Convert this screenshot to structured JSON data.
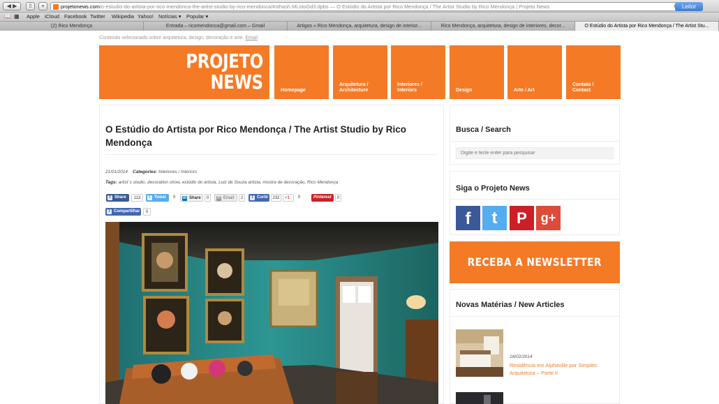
{
  "browser": {
    "url_domain": "projetonews.com",
    "url_rest": "/o-estudio-do-artista-por-rico-mendonca-the-artist-studio-by-rico-mendonca/#sthash.MLotoGd3.dpbs",
    "window_title": " — O Estúdio do Artista por Rico Mendonça / The Artist Studio by Rico Mendonça | Projeto News",
    "reader_label": "Leitor",
    "reload_glyph": "C",
    "bookmarks": [
      "Apple",
      "iCloud",
      "Facebook",
      "Twitter",
      "Wikipedia",
      "Yahoo!",
      "Notícias ▾",
      "Popular ▾"
    ],
    "tabs": [
      "(2) Rico Mendonça",
      "Entrada – ricomendonca@gmail.com – Gmail",
      "Artigos « Rico Mendonça, arquitetura, design de interior...",
      "Rico Mendonça, arquitetura, design de interiores, decor...",
      "O Estúdio do Artista por Rico Mendonça / The Artist Stu..."
    ]
  },
  "site": {
    "tagline": "Conteúdo selecionado sobre arquitetura, design, decoração e arte.",
    "tagline_link": "Email",
    "logo_line1": "PROJETO",
    "logo_line2": "NEWS",
    "menu": [
      "Homepage",
      "Arquitetura /\nArchitecture",
      "Interiores /\nInteriors",
      "Design",
      "Arte / Art",
      "Contato /\nContact"
    ]
  },
  "article": {
    "title": "O Estúdio do Artista por Rico Mendonça / The Artist Studio by Rico Mendonça",
    "date": "21/01/2014",
    "categories_label": "Categories:",
    "categories": "Interiores / Interiors",
    "tags_label": "Tags:",
    "tags": "artist´s studio, decoration show, estúdio do artista, Luiz de Souza artista, mostra de decoração, Rico Mendonça",
    "share": {
      "facebook_label": "Share",
      "facebook_count": "113",
      "twitter_label": "Tweet",
      "twitter_count": "0",
      "linkedin_label": "Share",
      "linkedin_count": "0",
      "email_label": "Email",
      "email_count": "2",
      "curtir_label": "Curtir",
      "curtir_count": "232",
      "gplus_label": "+1",
      "gplus_count": "0",
      "pinterest_label": "Pinterest",
      "pinterest_count": "0",
      "compartilhar_label": "Compartilhar",
      "compartilhar_count": "0"
    }
  },
  "sidebar": {
    "search_title": "Busca / Search",
    "search_placeholder": "Digite e tecle enter para pesquisar",
    "follow_title": "Siga o Projeto News",
    "social": [
      "f",
      "t",
      "P",
      "g+"
    ],
    "newsletter": "RECEBA A NEWSLETTER",
    "new_articles_title": "Novas Matérias / New Articles",
    "post_date": "18/02/2014",
    "post_title": "Residência em Alphaville por Simples Arquitetura – Parte II"
  },
  "colors": {
    "brand_orange": "#f47a26",
    "facebook": "#3b5998",
    "twitter": "#55acee",
    "pinterest": "#cb2027",
    "gplus": "#dd4b39"
  }
}
